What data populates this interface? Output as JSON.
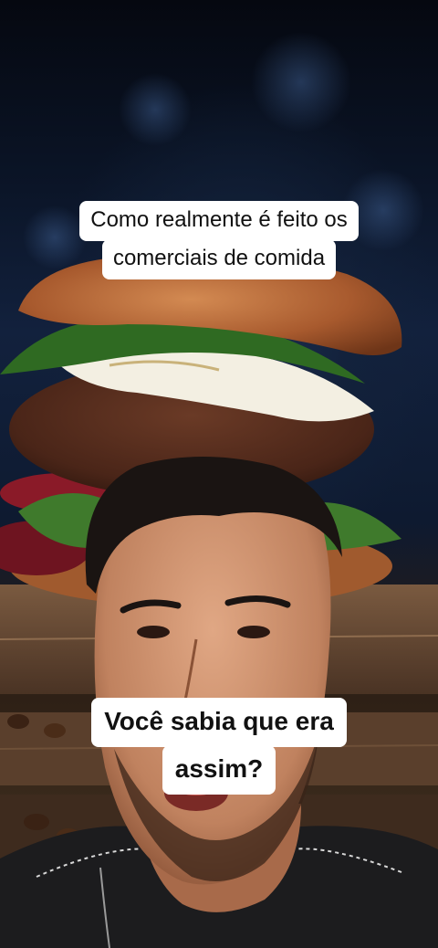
{
  "video": {
    "caption_top": {
      "lines": [
        "Como realmente é feito os",
        "comerciais de comida"
      ]
    },
    "caption_bottom": {
      "lines": [
        "Você sabia que era",
        "assim?"
      ]
    }
  },
  "colors": {
    "caption_background": "#ffffff",
    "caption_text": "#111111",
    "background_night": "#0b1528",
    "bun": "#b5683a",
    "patty": "#4a2a1c",
    "lettuce": "#3f7a2c",
    "cheese": "#f3efe2",
    "wood_board": "#6b4a33",
    "skin": "#c98b6a",
    "hair": "#1a1412"
  },
  "scene": {
    "subject": "man-face-overlay",
    "background_object": "burger-on-wooden-board"
  }
}
